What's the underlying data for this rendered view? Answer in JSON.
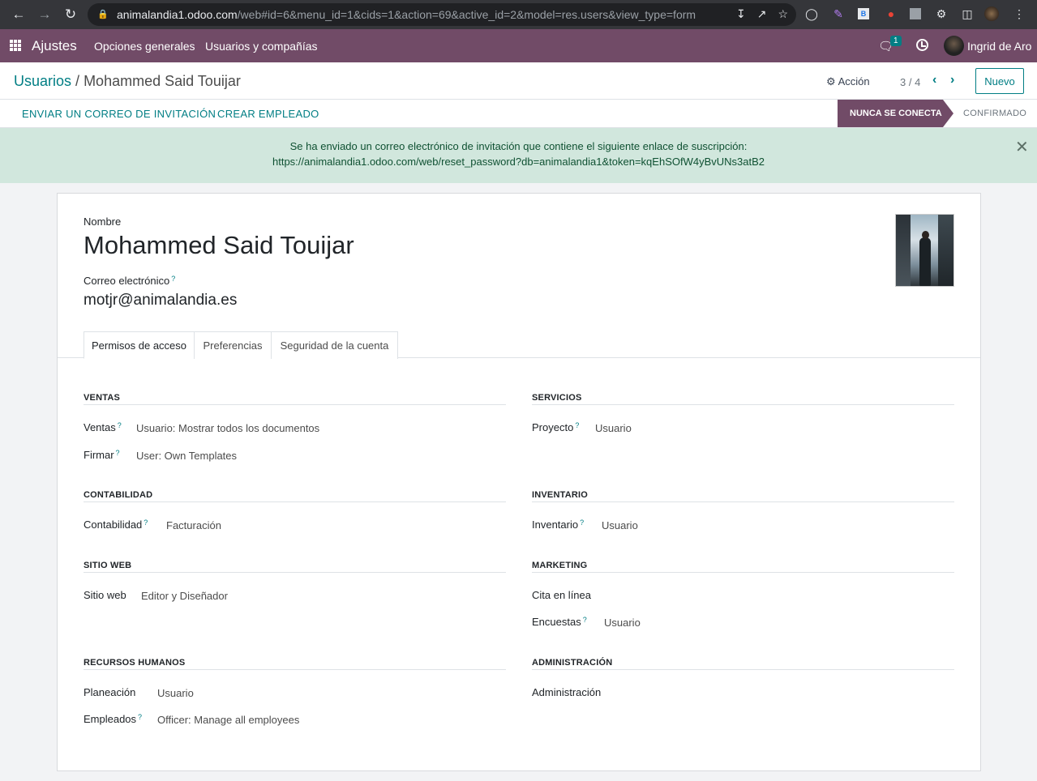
{
  "browser": {
    "url_host": "animalandia1.odoo.com",
    "url_path": "/web#id=6&menu_id=1&cids=1&action=69&active_id=2&model=res.users&view_type=form"
  },
  "navbar": {
    "app_name": "Ajustes",
    "menu": [
      "Opciones generales",
      "Usuarios y compañías"
    ],
    "chat_count": "1",
    "user_name": "Ingrid de Aro"
  },
  "breadcrumb": {
    "parent": "Usuarios",
    "current": "Mohammed Said Touijar"
  },
  "control": {
    "action_label": "Acción",
    "pager": "3 / 4",
    "new_label": "Nuevo"
  },
  "statusbar": {
    "buttons": [
      "ENVIAR UN CORREO DE INVITACIÓN",
      "CREAR EMPLEADO"
    ],
    "active_state": "NUNCA SE CONECTA",
    "next_state": "CONFIRMADO"
  },
  "alert": {
    "line1": "Se ha enviado un correo electrónico de invitación que contiene el siguiente enlace de suscripción:",
    "line2": "https://animalandia1.odoo.com/web/reset_password?db=animalandia1&token=kqEhSOfW4yBvUNs3atB2"
  },
  "form": {
    "name_label": "Nombre",
    "name": "Mohammed Said Touijar",
    "email_label": "Correo electrónico",
    "email": "motjr@animalandia.es"
  },
  "tabs": [
    "Permisos de acceso",
    "Preferencias",
    "Seguridad de la cuenta"
  ],
  "groups": {
    "ventas": {
      "title": "VENTAS",
      "fields": [
        {
          "label": "Ventas",
          "value": "Usuario: Mostrar todos los documentos"
        },
        {
          "label": "Firmar",
          "value": "User: Own Templates"
        }
      ]
    },
    "servicios": {
      "title": "SERVICIOS",
      "fields": [
        {
          "label": "Proyecto",
          "value": "Usuario"
        }
      ]
    },
    "contabilidad": {
      "title": "CONTABILIDAD",
      "fields": [
        {
          "label": "Contabilidad",
          "value": "Facturación"
        }
      ]
    },
    "inventario": {
      "title": "INVENTARIO",
      "fields": [
        {
          "label": "Inventario",
          "value": "Usuario"
        }
      ]
    },
    "sitio_web": {
      "title": "SITIO WEB",
      "fields": [
        {
          "label": "Sitio web",
          "value": "Editor y Diseñador"
        }
      ]
    },
    "marketing": {
      "title": "MARKETING",
      "fields": [
        {
          "label": "Cita en línea",
          "value": ""
        },
        {
          "label": "Encuestas",
          "value": "Usuario"
        }
      ]
    },
    "rrhh": {
      "title": "RECURSOS HUMANOS",
      "fields": [
        {
          "label": "Planeación",
          "value": "Usuario"
        },
        {
          "label": "Empleados",
          "value": "Officer: Manage all employees"
        }
      ]
    },
    "administracion": {
      "title": "ADMINISTRACIÓN",
      "fields": [
        {
          "label": "Administración",
          "value": ""
        }
      ]
    }
  }
}
